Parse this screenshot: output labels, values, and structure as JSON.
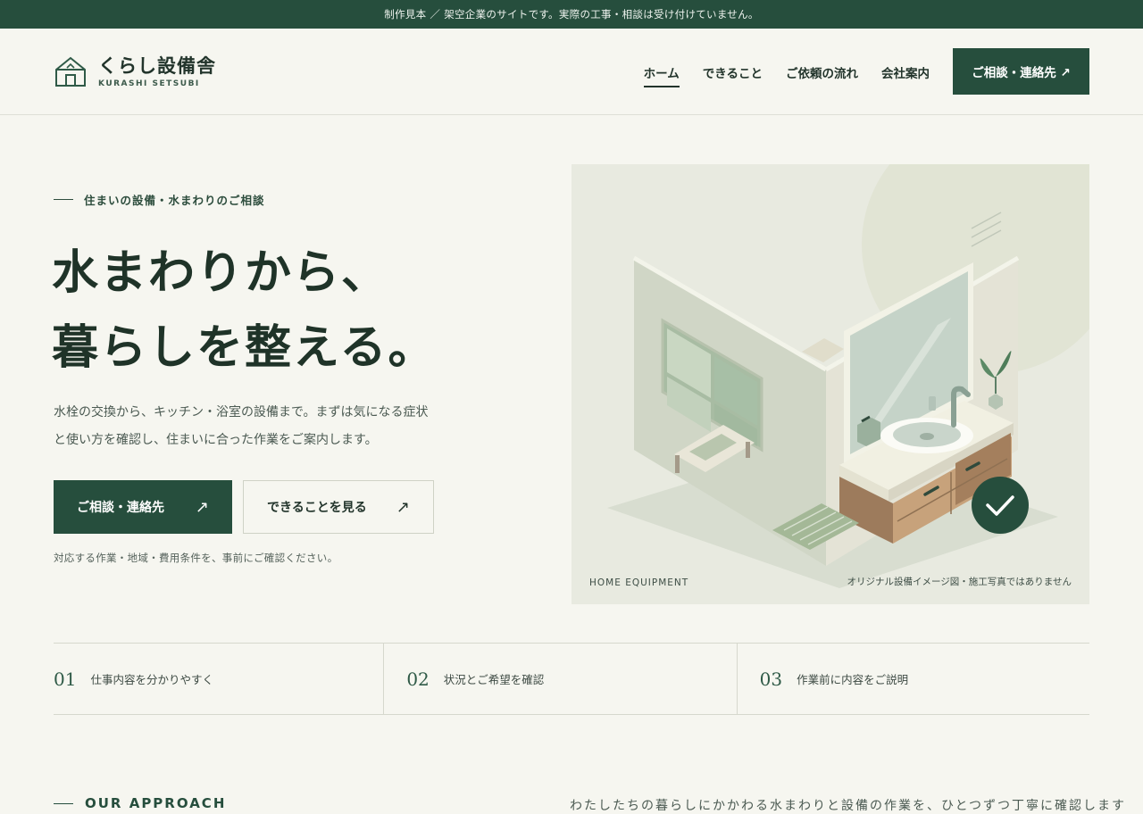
{
  "topbar": {
    "notice": "制作見本 ／ 架空企業のサイトです。実際の工事・相談は受け付けていません。"
  },
  "header": {
    "logo_title": "くらし設備舎",
    "logo_sub": "KURASHI SETSUBI",
    "nav": [
      "ホーム",
      "できること",
      "ご依頼の流れ",
      "会社案内"
    ],
    "cta": "ご相談・連絡先 ↗"
  },
  "hero": {
    "eyebrow": "住まいの設備・水まわりのご相談",
    "headline_line1": "水まわりから、",
    "headline_line2": "暮らしを整える。",
    "lead": "水栓の交換から、キッチン・浴室の設備まで。まずは気になる症状と使い方を確認し、住まいに合った作業をご案内します。",
    "btn_primary": "ご相談・連絡先",
    "btn_secondary": "できることを見る",
    "arrow": "↗",
    "note": "対応する作業・地域・費用条件を、事前にご確認ください。"
  },
  "illustration": {
    "caption_left": "HOME EQUIPMENT",
    "caption_right": "オリジナル設備イメージ図・施工写真ではありません",
    "colors": {
      "accent": "#264e3d",
      "wood": "#a6845f",
      "wall": "#d3d8c8"
    }
  },
  "features": [
    {
      "num": "01",
      "label": "仕事内容を分かりやすく"
    },
    {
      "num": "02",
      "label": "状況とご希望を確認"
    },
    {
      "num": "03",
      "label": "作業前に内容をご説明"
    }
  ],
  "approach": {
    "title": "OUR APPROACH",
    "text": "わたしたちの暮らしにかかわる水まわりと設備の作業を、ひとつずつ丁寧に確認します"
  }
}
